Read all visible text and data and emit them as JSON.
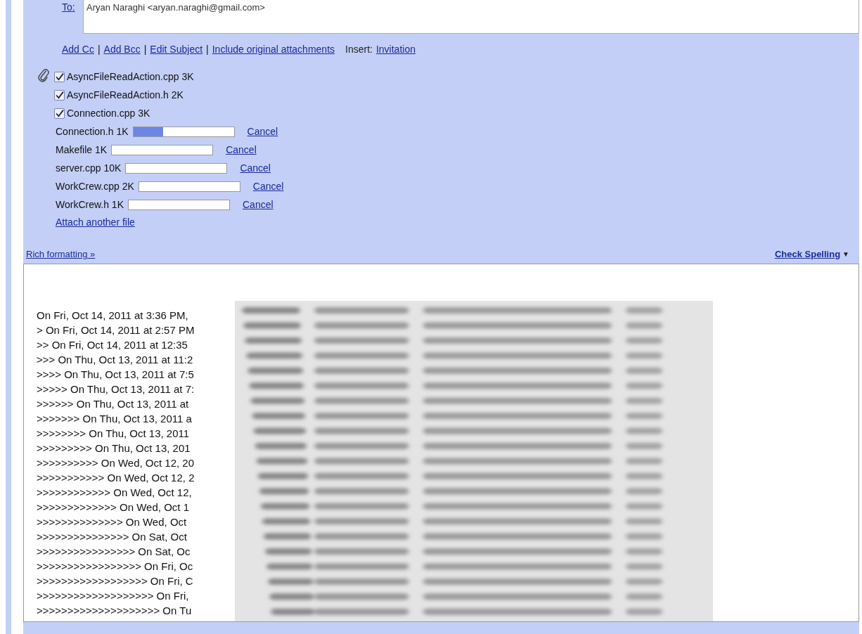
{
  "recipients": {
    "label": "To:",
    "value": "Aryan Naraghi <aryan.naraghi@gmail.com>"
  },
  "compose_links": [
    {
      "label": "Add Cc"
    },
    {
      "label": "Add Bcc"
    },
    {
      "label": "Edit Subject"
    },
    {
      "label": "Include original attachments"
    }
  ],
  "link_separator": "|",
  "insert": {
    "label": "Insert:",
    "link": "Invitation"
  },
  "attachments": [
    {
      "kind": "attached",
      "name": "AsyncFileReadAction.cpp 3K",
      "checked": true
    },
    {
      "kind": "attached",
      "name": "AsyncFileReadAction.h 2K",
      "checked": true
    },
    {
      "kind": "attached",
      "name": "Connection.cpp 3K",
      "checked": true
    },
    {
      "kind": "uploading",
      "name": "Connection.h 1K",
      "level": 0.3,
      "cancel": "Cancel"
    },
    {
      "kind": "uploading",
      "name": "Makefile 1K",
      "level": 0,
      "cancel": "Cancel"
    },
    {
      "kind": "uploading",
      "name": "server.cpp 10K",
      "level": 0,
      "cancel": "Cancel"
    },
    {
      "kind": "uploading",
      "name": "WorkCrew.cpp 2K",
      "level": 0,
      "cancel": "Cancel"
    },
    {
      "kind": "uploading",
      "name": "WorkCrew.h 1K",
      "level": 0,
      "cancel": "Cancel"
    }
  ],
  "attach_another": "Attach another file",
  "rich_formatting": "Rich formatting »",
  "check_spelling": {
    "label": "Check Spelling",
    "caret": "▼"
  },
  "body_lines": [
    "On Fri, Oct 14, 2011 at 3:36 PM,",
    "> On Fri, Oct 14, 2011 at 2:57 PM",
    ">> On Fri, Oct 14, 2011 at 12:35",
    ">>> On Thu, Oct 13, 2011 at 11:2",
    ">>>> On Thu, Oct 13, 2011 at 7:5",
    ">>>>> On Thu, Oct 13, 2011 at 7:",
    ">>>>>> On Thu, Oct 13, 2011 at",
    ">>>>>>> On Thu, Oct 13, 2011 a",
    ">>>>>>>> On Thu, Oct 13, 2011",
    ">>>>>>>>> On Thu, Oct 13, 201",
    ">>>>>>>>>> On Wed, Oct 12, 20",
    ">>>>>>>>>>> On Wed, Oct 12, 2",
    ">>>>>>>>>>>> On Wed, Oct 12,",
    ">>>>>>>>>>>>> On Wed, Oct 1",
    ">>>>>>>>>>>>>> On Wed, Oct",
    ">>>>>>>>>>>>>>> On Sat, Oct",
    ">>>>>>>>>>>>>>>> On Sat, Oc",
    ">>>>>>>>>>>>>>>>> On Fri, Oc",
    ">>>>>>>>>>>>>>>>>> On Fri, C",
    ">>>>>>>>>>>>>>>>>>> On Fri,",
    ">>>>>>>>>>>>>>>>>>>> On Tu"
  ]
}
